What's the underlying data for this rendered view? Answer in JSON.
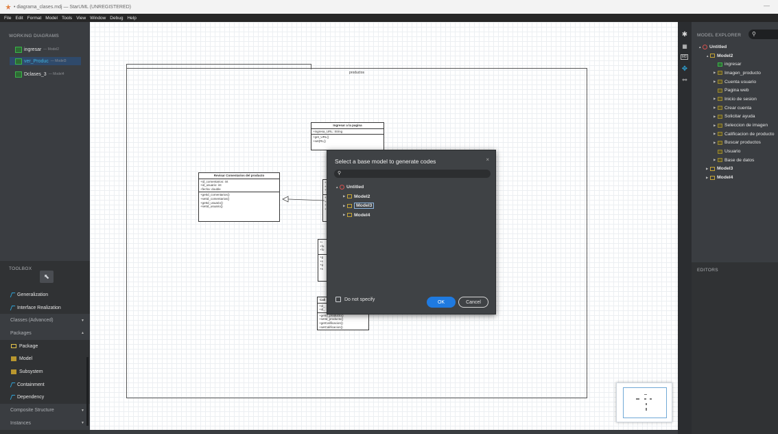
{
  "title_bar": {
    "text": "• diagrama_clases.mdj — StarUML (UNREGISTERED)",
    "minimize": "—"
  },
  "menu": [
    "File",
    "Edit",
    "Format",
    "Model",
    "Tools",
    "View",
    "Window",
    "Debug",
    "Help"
  ],
  "working_diagrams": {
    "title": "WORKING DIAGRAMS",
    "items": [
      {
        "name": "ingresar",
        "model": "— Model2"
      },
      {
        "name": "ver_Produc",
        "model": "— Model3"
      },
      {
        "name": "Dclases_3",
        "model": "— Model4"
      }
    ]
  },
  "toolbox": {
    "title": "TOOLBOX",
    "pointer": "⬉",
    "rows": [
      {
        "label": "Generalization",
        "kind": "tool",
        "icon": "generalization-icon"
      },
      {
        "label": "Interface Realization",
        "kind": "tool",
        "icon": "interface-realization-icon"
      },
      {
        "label": "Classes (Advanced)",
        "kind": "header",
        "arrow": "▼"
      },
      {
        "label": "Packages",
        "kind": "header",
        "arrow": "▲"
      },
      {
        "label": "Package",
        "kind": "tool",
        "icon": "package-icon"
      },
      {
        "label": "Model",
        "kind": "tool",
        "icon": "model-icon"
      },
      {
        "label": "Subsystem",
        "kind": "tool",
        "icon": "subsystem-icon"
      },
      {
        "label": "Containment",
        "kind": "tool",
        "icon": "containment-icon"
      },
      {
        "label": "Dependency",
        "kind": "tool",
        "icon": "dependency-icon"
      },
      {
        "label": "Composite Structure",
        "kind": "header",
        "arrow": "▼"
      },
      {
        "label": "Instances",
        "kind": "header",
        "arrow": "▼"
      }
    ]
  },
  "diagram": {
    "frame_label": "productos",
    "classes": {
      "ingresar": {
        "name": "Ingresar a la pagina",
        "attrs": [
          "+ingresa_URL: String"
        ],
        "ops": [
          "+get_URL()",
          "+set(RL()"
        ]
      },
      "revisar": {
        "name": "Revisar Comentarios del producto",
        "attrs": [
          "+id_comentarios: int",
          "+id_usuario: int",
          "+fecha: double"
        ],
        "ops": [
          "+getId_comentarios()",
          "+setId_comentarios()",
          "+getId_usuario()",
          "+setId_usuario()"
        ]
      },
      "calificacion": {
        "name": "Cali",
        "attrs": [
          "+id_",
          "+id_"
        ],
        "ops": [
          "+getId_producto()",
          "+setId_producto()",
          "+getCalificacion()",
          "+setCalificacion()"
        ]
      },
      "hidden_a": {
        "name": "",
        "attrs": [
          "+",
          "+",
          "+"
        ],
        "ops": [
          "+",
          "+",
          "+",
          "+"
        ]
      },
      "hidden_b": {
        "name": "",
        "attrs": [
          "+i",
          "+fu",
          "+fo"
        ],
        "ops": [
          "+g",
          "+s",
          "+g",
          "+s"
        ]
      }
    }
  },
  "model_explorer": {
    "title": "MODEL EXPLORER",
    "search_icon": "search-icon",
    "tree": [
      {
        "label": "Untitled",
        "depth": 0,
        "toggle": "▲",
        "icon": "project"
      },
      {
        "label": "Model2",
        "depth": 1,
        "toggle": "▲",
        "icon": "model"
      },
      {
        "label": "ingresar",
        "depth": 2,
        "toggle": "",
        "icon": "diag"
      },
      {
        "label": "Imagen_producto",
        "depth": 2,
        "toggle": "▶",
        "icon": "pkg"
      },
      {
        "label": "Cuenta usuario",
        "depth": 2,
        "toggle": "▶",
        "icon": "pkg"
      },
      {
        "label": "Pagina web",
        "depth": 2,
        "toggle": "",
        "icon": "pkg"
      },
      {
        "label": "Inicio de sesion",
        "depth": 2,
        "toggle": "▶",
        "icon": "pkg"
      },
      {
        "label": "Crear cuenta",
        "depth": 2,
        "toggle": "▶",
        "icon": "pkg"
      },
      {
        "label": "Solicitar ayuda",
        "depth": 2,
        "toggle": "▶",
        "icon": "pkg"
      },
      {
        "label": "Seleccion de imagen",
        "depth": 2,
        "toggle": "▶",
        "icon": "pkg"
      },
      {
        "label": "Calificacion de producto",
        "depth": 2,
        "toggle": "▶",
        "icon": "pkg"
      },
      {
        "label": "Buscar productos",
        "depth": 2,
        "toggle": "▶",
        "icon": "pkg"
      },
      {
        "label": "Usuario",
        "depth": 2,
        "toggle": "",
        "icon": "pkg"
      },
      {
        "label": "Base de datos",
        "depth": 2,
        "toggle": "▶",
        "icon": "pkg"
      },
      {
        "label": "Model3",
        "depth": 1,
        "toggle": "▶",
        "icon": "model"
      },
      {
        "label": "Model4",
        "depth": 1,
        "toggle": "▶",
        "icon": "model"
      }
    ]
  },
  "editors": {
    "title": "EDITORS"
  },
  "dialog": {
    "title": "Select a base model to generate codes",
    "close": "×",
    "search_icon": "search-icon",
    "tree": [
      {
        "label": "Untitled",
        "depth": 0,
        "toggle": "▲",
        "icon": "project",
        "selected": false
      },
      {
        "label": "Model2",
        "depth": 1,
        "toggle": "▶",
        "icon": "model",
        "selected": false
      },
      {
        "label": "Model3",
        "depth": 1,
        "toggle": "▶",
        "icon": "model",
        "selected": true
      },
      {
        "label": "Model4",
        "depth": 1,
        "toggle": "▶",
        "icon": "model",
        "selected": false
      }
    ],
    "checkbox_label": "Do not specify",
    "checkbox_checked": false,
    "ok_label": "OK",
    "cancel_label": "Cancel"
  },
  "colors": {
    "accent": "#1f7ae0",
    "panel": "#3a3d41",
    "selection": "#2f4a6b"
  }
}
